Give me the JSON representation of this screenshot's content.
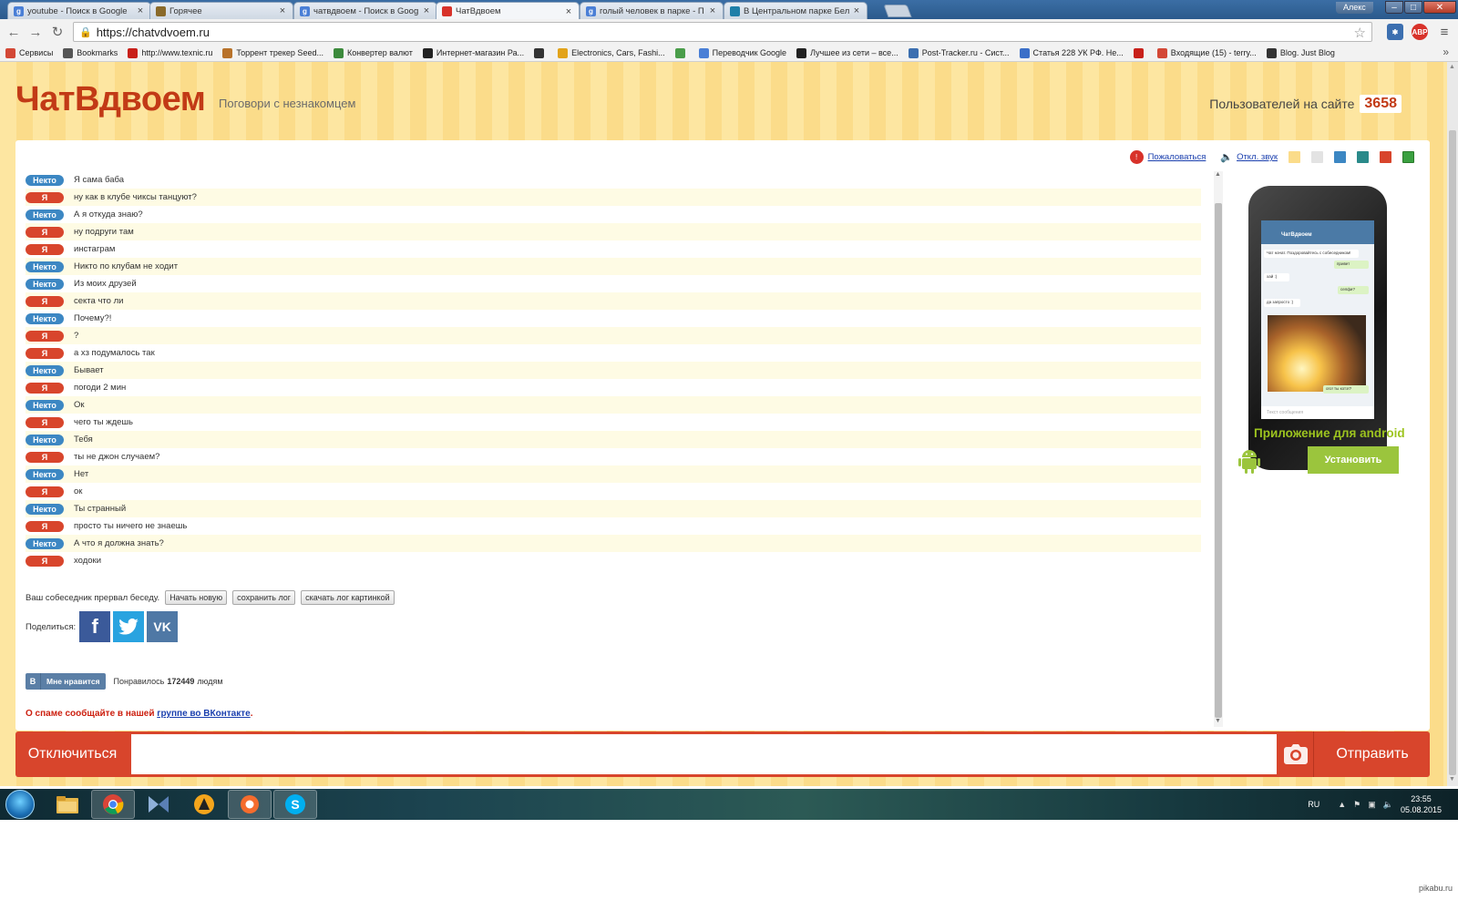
{
  "browser": {
    "tabs": [
      {
        "title": "youtube - Поиск в Google",
        "icon": "google-icon",
        "color": "#4a7fd6",
        "glyph": "g",
        "active": false
      },
      {
        "title": "Горячее",
        "icon": "pikabu-icon",
        "color": "#8a6a2a",
        "glyph": "",
        "active": false
      },
      {
        "title": "чатвдвоем - Поиск в Goog",
        "icon": "google-icon",
        "color": "#4a7fd6",
        "glyph": "g",
        "active": false
      },
      {
        "title": "ЧатВдвоем",
        "icon": "chat-icon",
        "color": "#d8322a",
        "glyph": "",
        "active": true
      },
      {
        "title": "голый человек в парке - П",
        "icon": "google-icon",
        "color": "#4a7fd6",
        "glyph": "g",
        "active": false
      },
      {
        "title": "В Центральном парке Бел",
        "icon": "news-icon",
        "color": "#1f7fa8",
        "glyph": "",
        "active": false
      }
    ],
    "user_name": "Алекс",
    "url": "https://chatvdvoem.ru",
    "bookmarks": [
      {
        "label": "Сервисы",
        "icon": "apps-icon",
        "color": "#d34836"
      },
      {
        "label": "Bookmarks",
        "icon": "star-icon",
        "color": "#555555"
      },
      {
        "label": "http://www.texnic.ru",
        "icon": "flag-icon",
        "color": "#c8201a"
      },
      {
        "label": "Торрент трекер Seed...",
        "icon": "torrent-icon",
        "color": "#b8722a"
      },
      {
        "label": "Конвертер валют",
        "icon": "currency-icon",
        "color": "#3c8a3c"
      },
      {
        "label": "Интернет-магазин Ра...",
        "icon": "shop-icon",
        "color": "#222222"
      },
      {
        "label": "",
        "icon": "globe-icon",
        "color": "#333333"
      },
      {
        "label": "Electronics, Cars, Fashi...",
        "icon": "ebay-icon",
        "color": "#e2a31a"
      },
      {
        "label": "",
        "icon": "grid-icon",
        "color": "#4a9d4a"
      },
      {
        "label": "Переводчик Google",
        "icon": "translate-icon",
        "color": "#4a7fd6"
      },
      {
        "label": "Лучшее из сети – все...",
        "icon": "n-icon",
        "color": "#222222"
      },
      {
        "label": "Post-Tracker.ru - Сист...",
        "icon": "package-icon",
        "color": "#3c6fb0"
      },
      {
        "label": "Статья 228 УК РФ. Не...",
        "icon": "z-icon",
        "color": "#3b6fc8"
      },
      {
        "label": "",
        "icon": "mail-flag-icon",
        "color": "#c8201a"
      },
      {
        "label": "Входящие (15) - terry...",
        "icon": "gmail-icon",
        "color": "#d34836"
      },
      {
        "label": "Blog. Just Blog",
        "icon": "blog-icon",
        "color": "#333333"
      }
    ]
  },
  "site": {
    "logo": "ЧатВдвоем",
    "tagline": "Поговори с незнакомцем",
    "users_label": "Пользователей на сайте",
    "users_count": "3658",
    "report_label": "Пожаловаться",
    "sound_label": "Откл. звук",
    "theme_colors": [
      "#fbdc8a",
      "#e3e3e3",
      "#3c87c3",
      "#2a8a8a",
      "#d8452c",
      "#3aa040"
    ]
  },
  "chat": {
    "stranger_label": "Некто",
    "me_label": "Я",
    "messages": [
      {
        "from": "stranger",
        "text": "Я сама баба"
      },
      {
        "from": "me",
        "text": "ну как в клубе чиксы танцуют?"
      },
      {
        "from": "stranger",
        "text": "А я откуда знаю?"
      },
      {
        "from": "me",
        "text": "ну подруги там"
      },
      {
        "from": "me",
        "text": "инстаграм"
      },
      {
        "from": "stranger",
        "text": "Никто по клубам не ходит"
      },
      {
        "from": "stranger",
        "text": "Из моих друзей"
      },
      {
        "from": "me",
        "text": "секта что ли"
      },
      {
        "from": "stranger",
        "text": "Почему?!"
      },
      {
        "from": "me",
        "text": "?"
      },
      {
        "from": "me",
        "text": "а хз подумалось так"
      },
      {
        "from": "stranger",
        "text": "Бывает"
      },
      {
        "from": "me",
        "text": "погоди 2 мин"
      },
      {
        "from": "stranger",
        "text": "Ок"
      },
      {
        "from": "me",
        "text": "чего ты ждешь"
      },
      {
        "from": "stranger",
        "text": "Тебя"
      },
      {
        "from": "me",
        "text": "ты не джон случаем?"
      },
      {
        "from": "stranger",
        "text": "Нет"
      },
      {
        "from": "me",
        "text": "ок"
      },
      {
        "from": "stranger",
        "text": "Ты странный"
      },
      {
        "from": "me",
        "text": "просто ты ничего не знаешь"
      },
      {
        "from": "stranger",
        "text": "А что я должна знать?"
      },
      {
        "from": "me",
        "text": "ходоки"
      }
    ],
    "ended_text": "Ваш собеседник прервал беседу.",
    "new_chat_label": "Начать новую",
    "save_log_label": "сохранить лог",
    "download_image_label": "скачать лог картинкой",
    "share_label": "Поделиться:",
    "like_button_label": "Мне нравится",
    "like_prefix": "Понравилось",
    "like_count": "172449",
    "like_suffix": "людям",
    "spam_prefix": "О спаме сообщайте в нашей",
    "spam_link": "группе во ВКонтакте",
    "spam_suffix": "."
  },
  "promo": {
    "app_title": "ЧатВдвоем",
    "bubbles": [
      "Чат начат. Поздоровайтесь с собеседником!",
      "привет",
      "хай :)",
      "селфи?",
      "да запросто :)",
      "ого! ты котэ!?"
    ],
    "input_placeholder": "Текст сообщения",
    "caption": "Приложение для android",
    "install_label": "Установить"
  },
  "bottom": {
    "disconnect_label": "Отключиться",
    "send_label": "Отправить"
  },
  "taskbar": {
    "lang": "RU",
    "time": "23:55",
    "date": "05.08.2015"
  },
  "watermark": "pikabu.ru"
}
